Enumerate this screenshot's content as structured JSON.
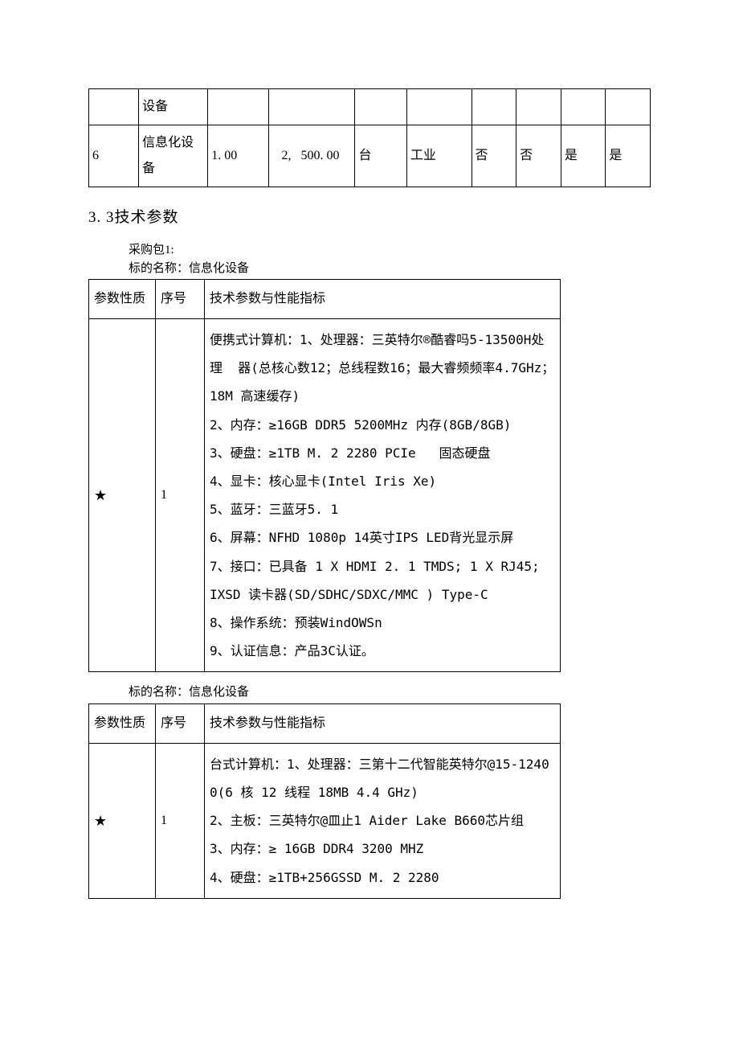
{
  "top_table": {
    "row0": {
      "name_cell": "设备"
    },
    "row1": {
      "num": "6",
      "name": "信息化设备",
      "qty": "1. 00",
      "price": "   2,   500. 00",
      "unit": "台",
      "industry": "工业",
      "c7": "否",
      "c8": "否",
      "c9": "是",
      "c10": "是"
    }
  },
  "section_title": "3. 3技术参数",
  "package_label": "采购包1:",
  "target_label_prefix": "标的名称：",
  "target_name": "信息化设备",
  "param_table": {
    "h1": "参数性质",
    "h2": "序号",
    "h3": "技术参数与性能指标"
  },
  "spec1": {
    "star": "★",
    "seq": "1",
    "text": "便携式计算机：1、处理器：三英特尔®酷睿吗5-13500H处理  器(总核心数12；总线程数16；最大睿频频率4.7GHz；   18M 高速缓存)\n2、内存：≥16GB DDR5 5200MHz 内存(8GB/8GB)\n3、硬盘：≥1TB M. 2 2280 PCIe   固态硬盘\n4、显卡：核心显卡(Intel Iris Xe)\n5、蓝牙：三蓝牙5. 1\n6、屏幕：NFHD 1080p 14英寸IPS LED背光显示屏\n7、接口：已具备 1 X HDMI 2. 1 TMDS; 1 X RJ45; IXSD 读卡器(SD/SDHC/SDXC/MMC ) Type-C\n8、操作系统：预装WindOWSn\n9、认证信息：产品3C认证。"
  },
  "spec2": {
    "star": "★",
    "seq": "1",
    "text": "台式计算机：1、处理器：三第十二代智能英特尔@15-1240 0(6 核 12 线程 18MB 4.4 GHz)\n2、主板：三英特尔@皿止1 Aider Lake B660芯片组\n3、内存：≥ 16GB DDR4 3200 MHZ\n4、硬盘：≥1TB+256GSSD M. 2 2280"
  }
}
